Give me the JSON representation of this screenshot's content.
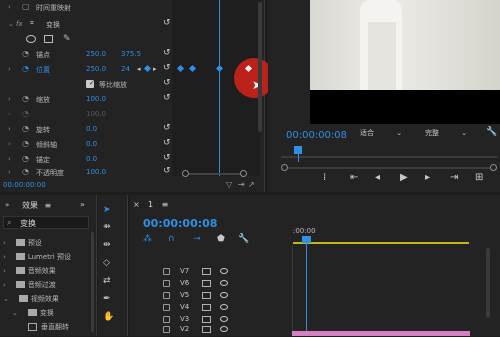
{
  "effect_controls": {
    "time_remap_label": "时间重映射",
    "transform_label": "变换",
    "rows": [
      {
        "label": "锚点",
        "v1": "250.0",
        "v2": "375.5"
      },
      {
        "label": "位置",
        "v1": "250.0",
        "v2": "24"
      },
      {
        "label": "等比缩放",
        "checkbox": true
      },
      {
        "label": "缩放",
        "v1": "100.0"
      },
      {
        "label": "",
        "v1": "100.0"
      },
      {
        "label": "旋转",
        "v1": "0.0"
      },
      {
        "label": "倾斜轴",
        "v1": "0.0"
      },
      {
        "label": "锚定",
        "v1": "0.0"
      },
      {
        "label": "不透明度",
        "v1": "100.0"
      }
    ],
    "timecode": "00:00:00:00",
    "reset_glyph": "↺"
  },
  "program_monitor": {
    "timecode": "00:00:00:08",
    "fit_option": "适合",
    "quality_option": "完整"
  },
  "effects_panel": {
    "tab_label": "效果",
    "search_value": "变换",
    "items": [
      {
        "label": "预设"
      },
      {
        "label": "Lumetri 预设"
      },
      {
        "label": "音频效果"
      },
      {
        "label": "音频过渡"
      },
      {
        "label": "视频效果"
      },
      {
        "label": "变换"
      },
      {
        "label": "垂直翻转"
      }
    ]
  },
  "timeline": {
    "tab_number": "1",
    "timecode": "00:00:00:08",
    "ruler_start": ":00:00",
    "tracks": [
      "V7",
      "V6",
      "V5",
      "V4",
      "V3",
      "V2"
    ]
  },
  "colors": {
    "accent_blue": "#2e8fe6",
    "work_area_yellow": "#c9b41a",
    "clip_pink": "#d77fc4",
    "cursor_highlight": "#c8231b"
  }
}
